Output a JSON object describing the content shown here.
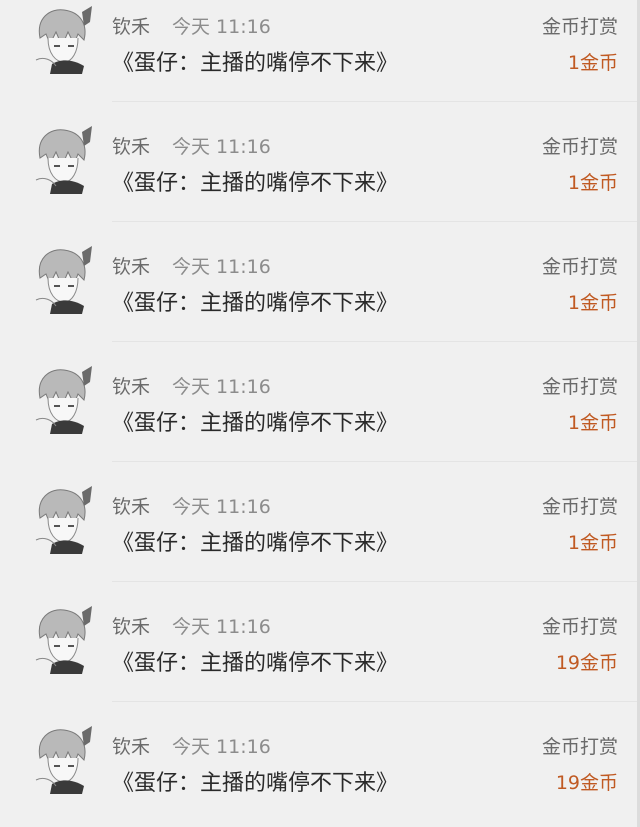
{
  "records": [
    {
      "user": "钦禾",
      "time": "今天 11:16",
      "title": "《蛋仔：主播的嘴停不下来》",
      "type_label": "金币打赏",
      "amount": "1金币"
    },
    {
      "user": "钦禾",
      "time": "今天 11:16",
      "title": "《蛋仔：主播的嘴停不下来》",
      "type_label": "金币打赏",
      "amount": "1金币"
    },
    {
      "user": "钦禾",
      "time": "今天 11:16",
      "title": "《蛋仔：主播的嘴停不下来》",
      "type_label": "金币打赏",
      "amount": "1金币"
    },
    {
      "user": "钦禾",
      "time": "今天 11:16",
      "title": "《蛋仔：主播的嘴停不下来》",
      "type_label": "金币打赏",
      "amount": "1金币"
    },
    {
      "user": "钦禾",
      "time": "今天 11:16",
      "title": "《蛋仔：主播的嘴停不下来》",
      "type_label": "金币打赏",
      "amount": "1金币"
    },
    {
      "user": "钦禾",
      "time": "今天 11:16",
      "title": "《蛋仔：主播的嘴停不下来》",
      "type_label": "金币打赏",
      "amount": "19金币"
    },
    {
      "user": "钦禾",
      "time": "今天 11:16",
      "title": "《蛋仔：主播的嘴停不下来》",
      "type_label": "金币打赏",
      "amount": "19金币"
    }
  ],
  "colors": {
    "background": "#f0f0f0",
    "amount": "#c05a23",
    "title": "#2a2a2a",
    "muted": "#6a6a6a"
  },
  "icons": {
    "avatar": "anime-character-avatar-icon"
  }
}
